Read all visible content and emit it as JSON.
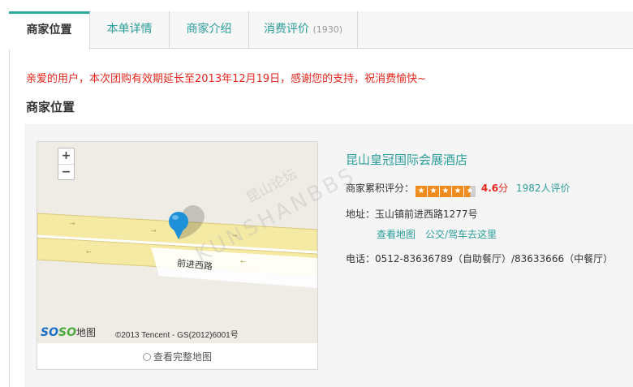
{
  "tabs": [
    {
      "label": "商家位置"
    },
    {
      "label": "本单详情"
    },
    {
      "label": "商家介绍"
    },
    {
      "label": "消费评价",
      "count": "(1930)"
    }
  ],
  "notice": "亲爱的用户，本次团购有效期延长至2013年12月19日，感谢您的支持，祝消费愉快~",
  "section_title": "商家位置",
  "map": {
    "zoom_in": "+",
    "zoom_out": "−",
    "road_name": "前进西路",
    "logo_part1": "SO",
    "logo_part2": "SO",
    "logo_suffix": "地图",
    "copyright": "©2013 Tencent - GS(2012)6001号",
    "full_map_link": "查看完整地图"
  },
  "shop": {
    "name": "昆山皇冠国际会展酒店",
    "rating_label": "商家累积评分：",
    "rating_value": "4.6",
    "rating_unit": "分",
    "review_count": "1982人评价",
    "address_label": "地址：",
    "address": "玉山镇前进西路1277号",
    "view_map": "查看地图",
    "directions": "公交/驾车去这里",
    "phone_label": "电话：",
    "phone": "0512-83636789（自助餐厅）/83633666（中餐厅）"
  },
  "watermark": {
    "cn": "昆山论坛",
    "en": "KUNSHANBBS"
  },
  "colors": {
    "accent": "#2a9d9a",
    "notice": "#e4261c",
    "star": "#f08b1d",
    "road": "#f5eaa4",
    "pin": "#1e90d8"
  }
}
